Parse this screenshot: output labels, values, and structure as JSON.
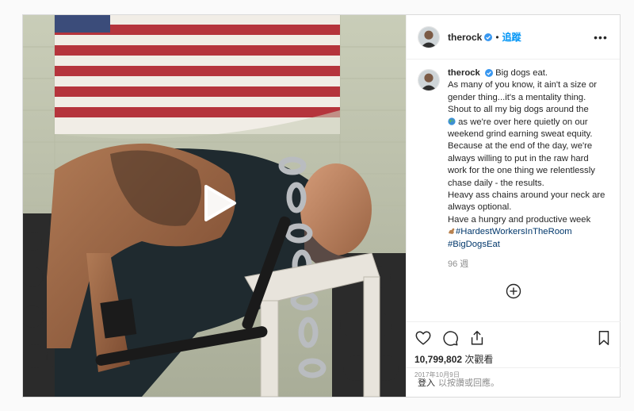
{
  "post": {
    "username": "therock",
    "follow_label": "追蹤",
    "more_label": "•••",
    "caption": {
      "first_line_text": "Big dogs eat.",
      "lines": [
        "As many of you know, it ain't a size or",
        "gender thing...it's a mentality thing.",
        "Shout to all my big dogs around the",
        "as we're over here quietly on our",
        "weekend grind earning sweat equity.",
        "Because at the end of the day, we're",
        "always willing to put in the raw hard",
        "work for the one thing we relentlessly",
        "chase daily - the results.",
        "Heavy ass chains around your neck are",
        "always optional.",
        "Have a hungry and productive week"
      ],
      "hashtags": [
        "#HardestWorkersInTheRoom",
        "#BigDogsEat"
      ],
      "time_ago": "96 週"
    },
    "views_count": "10,799,802",
    "views_label": "次觀看",
    "date": "2017年10月9日",
    "login_label": "登入",
    "comment_prompt": "以按讚或回應。"
  },
  "icons": {
    "play": "play-icon",
    "verified": "verified-badge-icon",
    "globe": "globe-emoji-icon",
    "flex": "flexed-biceps-emoji-icon",
    "load_more": "plus-circle-icon",
    "like": "heart-icon",
    "comment": "comment-icon",
    "share": "share-icon",
    "save": "bookmark-icon"
  },
  "colors": {
    "link_blue": "#0095f6",
    "hashtag": "#00376b",
    "muted": "#8e8e8e",
    "verified": "#3897f0"
  }
}
